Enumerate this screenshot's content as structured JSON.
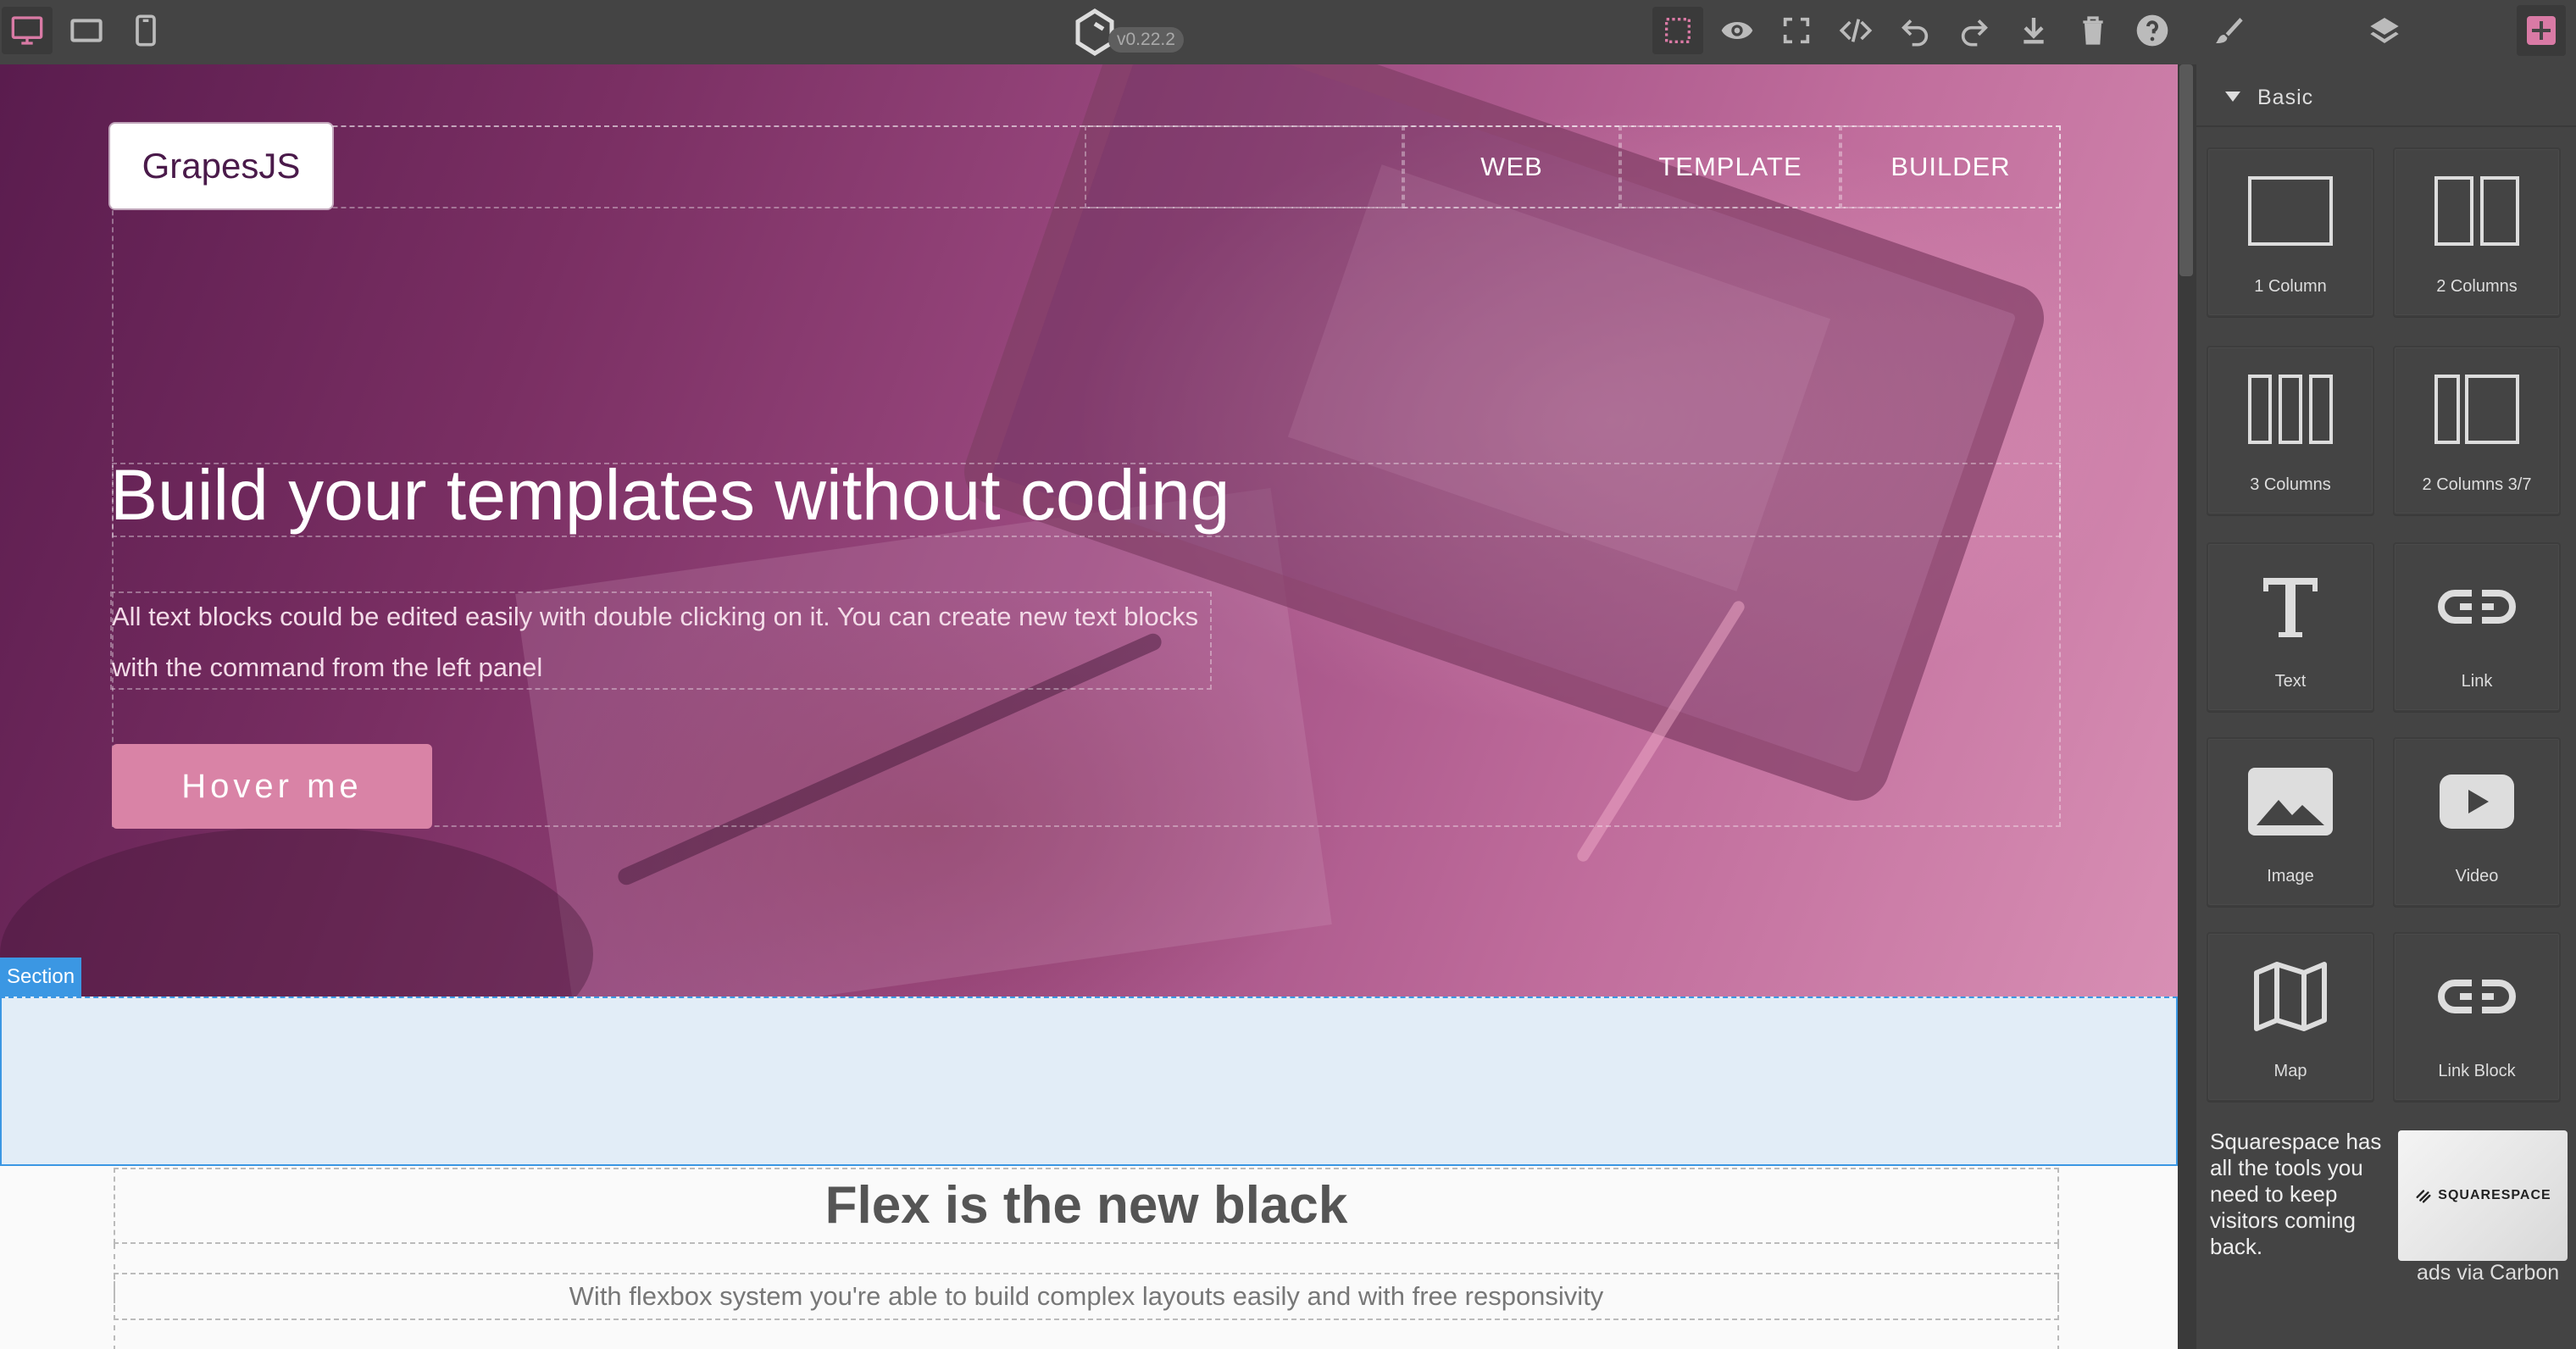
{
  "app": {
    "version": "v0.22.2",
    "accent_color": "#d97aa5",
    "panel_bg": "#444444"
  },
  "toolbar": {
    "devices": [
      {
        "name": "desktop",
        "icon": "desktop-icon",
        "active": true
      },
      {
        "name": "tablet",
        "icon": "tablet-icon",
        "active": false
      },
      {
        "name": "mobile",
        "icon": "mobile-icon",
        "active": false
      }
    ],
    "options": [
      {
        "name": "sw-visibility",
        "icon": "dashed-square-icon",
        "active": true
      },
      {
        "name": "preview",
        "icon": "eye-icon",
        "active": false
      },
      {
        "name": "fullscreen",
        "icon": "fullscreen-icon",
        "active": false
      },
      {
        "name": "export-code",
        "icon": "code-icon",
        "active": false
      },
      {
        "name": "undo",
        "icon": "undo-icon",
        "active": false
      },
      {
        "name": "redo",
        "icon": "redo-icon",
        "active": false
      },
      {
        "name": "import",
        "icon": "download-icon",
        "active": false
      },
      {
        "name": "clear-canvas",
        "icon": "trash-icon",
        "active": false
      },
      {
        "name": "help",
        "icon": "question-icon",
        "active": false
      }
    ],
    "panels": [
      {
        "name": "style-manager",
        "icon": "brush-icon",
        "active": false
      },
      {
        "name": "layer-manager",
        "icon": "layers-icon",
        "active": false
      },
      {
        "name": "blocks",
        "icon": "plus-square-icon",
        "active": true
      }
    ]
  },
  "canvas": {
    "brand": "GrapesJS",
    "nav": [
      "WEB",
      "TEMPLATE",
      "BUILDER"
    ],
    "hero_title": "Build your templates without coding",
    "hero_text": "All text blocks could be edited easily with double clicking on it. You can create new text blocks with the command from the left panel",
    "hero_button": "Hover me",
    "selected_badge": "Section",
    "flex_title": "Flex is the new black",
    "flex_subtitle": "With flexbox system you're able to build complex layouts easily and with free responsivity"
  },
  "blocks_panel": {
    "category": "Basic",
    "blocks": [
      {
        "label": "1 Column",
        "icon": "one-column-icon"
      },
      {
        "label": "2 Columns",
        "icon": "two-columns-icon"
      },
      {
        "label": "3 Columns",
        "icon": "three-columns-icon"
      },
      {
        "label": "2 Columns 3/7",
        "icon": "two-columns-3-7-icon"
      },
      {
        "label": "Text",
        "icon": "text-icon"
      },
      {
        "label": "Link",
        "icon": "link-icon"
      },
      {
        "label": "Image",
        "icon": "image-icon"
      },
      {
        "label": "Video",
        "icon": "video-icon"
      },
      {
        "label": "Map",
        "icon": "map-icon"
      },
      {
        "label": "Link Block",
        "icon": "link-block-icon"
      }
    ]
  },
  "ad": {
    "text": "Squarespace has all the tools you need to keep visitors coming back.",
    "image_brand": "SQUARESPACE",
    "via": "ads via Carbon"
  }
}
